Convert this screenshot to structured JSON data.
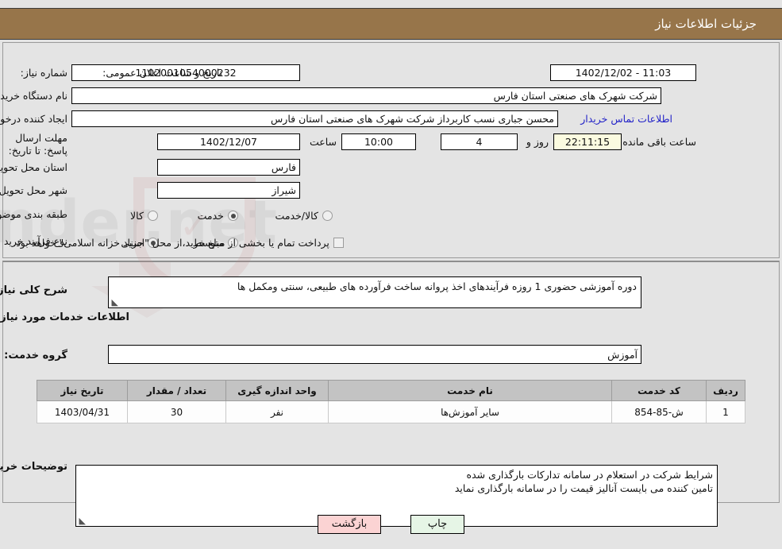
{
  "header": {
    "title": "جزئیات اطلاعات نیاز"
  },
  "top_form": {
    "need_number_label": "شماره نیاز:",
    "need_number_value": "1102001054000232",
    "announce_label": "تاریخ و ساعت اعلان عمومی:",
    "announce_value": "11:03 - 1402/12/02",
    "buyer_org_label": "نام دستگاه خریدار:",
    "buyer_org_value": "شرکت شهرک های صنعتی استان فارس",
    "creator_label": "ایجاد کننده درخواست:",
    "creator_value": "محسن  جباری نسب کاربرداز شرکت شهرک های صنعتی استان فارس",
    "contact_link": "اطلاعات تماس خریدار",
    "deadline_label": "مهلت ارسال پاسخ: تا تاریخ:",
    "deadline_date": "1402/12/07",
    "deadline_hour_label": "ساعت",
    "deadline_hour": "10:00",
    "remaining_days": "4",
    "remaining_days_label": "روز و",
    "remaining_timer": "22:11:15",
    "remaining_suffix": "ساعت باقی مانده",
    "province_label": "استان محل تحویل:",
    "province_value": "فارس",
    "city_label": "شهر محل تحویل:",
    "city_value": "شیراز",
    "category_label": "طبقه بندی موضوعی:",
    "category_options": [
      {
        "label": "کالا",
        "selected": false
      },
      {
        "label": "خدمت",
        "selected": true
      },
      {
        "label": "کالا/خدمت",
        "selected": false
      }
    ],
    "process_label": "نوع فرآیند خرید :",
    "process_options": [
      {
        "label": "جزیی",
        "selected": true
      },
      {
        "label": "متوسط",
        "selected": false
      }
    ],
    "treasury_checkbox_checked": false,
    "treasury_note": "پرداخت تمام یا بخشی از مبلغ خرید،از محل \"اسناد خزانه اسلامی\" خواهد بود."
  },
  "bottom_form": {
    "need_desc_label": "شرح کلی نیاز:",
    "need_desc_value": "دوره آموزشی حضوری 1 روزه فرآیندهای اخذ پروانه ساخت فرآورده های طبیعی، سنتی ومکمل ها",
    "services_section_title": "اطلاعات خدمات مورد نیاز",
    "service_group_label": "گروه خدمت:",
    "service_group_value": "آموزش",
    "table": {
      "columns": [
        "ردیف",
        "کد خدمت",
        "نام خدمت",
        "واحد اندازه گیری",
        "تعداد / مقدار",
        "تاریخ نیاز"
      ],
      "rows": [
        [
          "1",
          "ش-85-854",
          "سایر آموزش‌ها",
          "نفر",
          "30",
          "1403/04/31"
        ]
      ]
    },
    "buyer_comments_label": "توضیحات خریدار:",
    "buyer_comments_lines": [
      "شرایط شرکت در استعلام در سامانه تدارکات بارگذاری شده",
      "تامین کننده می بایست آنالیز قیمت را در سامانه بارگذاری نماید"
    ]
  },
  "footer": {
    "print_label": "چاپ",
    "back_label": "بازگشت"
  },
  "colors": {
    "header_bg": "#97754a",
    "page_bg": "#e4e4e4",
    "link": "#2323c8",
    "timer_bg": "#fbfbe0",
    "print_bg": "#e6f5e6",
    "back_bg": "#fbd3d3",
    "table_header_bg": "#c3c3c3"
  }
}
